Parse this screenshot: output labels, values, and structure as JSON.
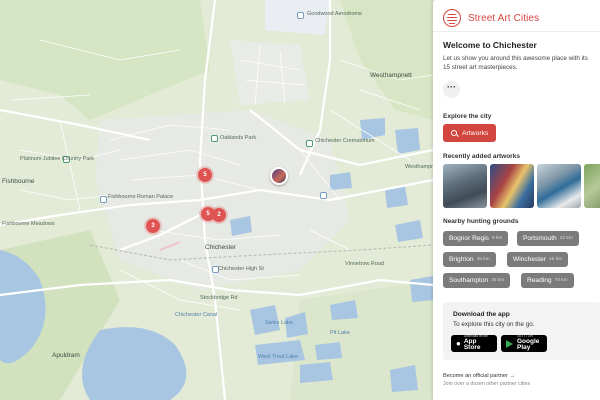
{
  "brand": {
    "name": "Street Art Cities",
    "accent_color": "#d9463f"
  },
  "welcome": {
    "title": "Welcome to Chichester",
    "intro": "Let us show you around this awesome place with its 15 street art masterpieces.",
    "more_label": "···"
  },
  "explore": {
    "label": "Explore the city",
    "button_label": "Artworks"
  },
  "recent": {
    "label": "Recently added artworks",
    "thumbs": [
      "artwork-1",
      "artwork-2",
      "artwork-3",
      "artwork-4"
    ]
  },
  "nearby": {
    "label": "Nearby hunting grounds",
    "cities": [
      {
        "name": "Bognor Regis",
        "km": "9 km"
      },
      {
        "name": "Portsmouth",
        "km": "22 km"
      },
      {
        "name": "Brighton",
        "km": "45 km"
      },
      {
        "name": "Winchester",
        "km": "45 km"
      },
      {
        "name": "Southampton",
        "km": "45 km"
      },
      {
        "name": "Reading",
        "km": "70 km"
      }
    ]
  },
  "app": {
    "title": "Download the app",
    "subtitle": "To explore this city on the go.",
    "appstore_small": "Download on the",
    "appstore_name": "App Store",
    "googleplay_small": "GET IT ON",
    "googleplay_name": "Google Play"
  },
  "partner": {
    "title": "Become an official partner →",
    "subtitle": "Join over a dozen other partner cities"
  },
  "map": {
    "markers": [
      {
        "count": "5"
      },
      {
        "count": "5"
      },
      {
        "count": "2"
      },
      {
        "count": "3"
      }
    ],
    "labels": {
      "aerodrome": "Goodwood Aerodrome",
      "westhampnett": "Westhampnett",
      "oaklands": "Oaklands Park",
      "crematorium": "Chichester Crematorium",
      "jubilee": "Platinum Jubilee Country Park",
      "fishbourne": "Fishbourne",
      "fishbourne_meadows": "Fishbourne Meadows",
      "roman_palace": "Fishbourne Roman Palace",
      "high_st": "Chichester High St",
      "chichester": "Chichester",
      "apuldram": "Apuldram",
      "chichester_canal": "Chichester Canal",
      "west_trout": "West Trout Lake",
      "pit": "Pit Lake",
      "vinnetrow": "Vinnetrow Road",
      "stockbridge": "Stockbridge Rd",
      "westhampnett_house": "Westhampnett House",
      "swiss_lake": "Swiss Lake"
    }
  }
}
